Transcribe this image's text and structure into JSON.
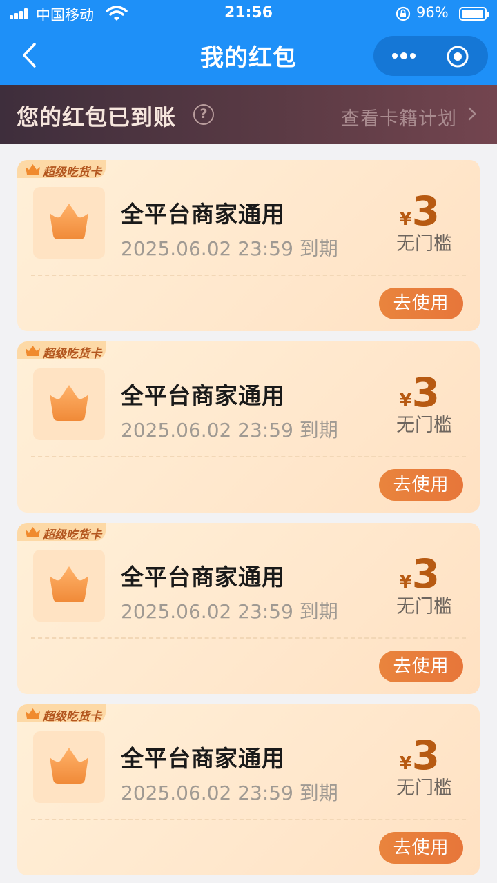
{
  "status_bar": {
    "carrier": "中国移动",
    "time": "21:56",
    "battery_pct": "96%",
    "battery_level": 0.96
  },
  "nav": {
    "title": "我的红包",
    "back_icon": "chevron-left-icon",
    "more_icon": "more-dots-icon",
    "close_icon": "target-icon"
  },
  "banner": {
    "title": "您的红包已到账",
    "link": "查看卡籍计划"
  },
  "colors": {
    "nav_blue": "#1e90f8",
    "accent_orange": "#e9843d",
    "price_brown": "#b75a12"
  },
  "cards": [
    {
      "badge": "超级吃货卡",
      "title": "全平台商家通用",
      "expiry": "2025.06.02 23:59 到期",
      "currency": "¥",
      "amount": "3",
      "threshold": "无门槛",
      "button": "去使用"
    },
    {
      "badge": "超级吃货卡",
      "title": "全平台商家通用",
      "expiry": "2025.06.02 23:59 到期",
      "currency": "¥",
      "amount": "3",
      "threshold": "无门槛",
      "button": "去使用"
    },
    {
      "badge": "超级吃货卡",
      "title": "全平台商家通用",
      "expiry": "2025.06.02 23:59 到期",
      "currency": "¥",
      "amount": "3",
      "threshold": "无门槛",
      "button": "去使用"
    },
    {
      "badge": "超级吃货卡",
      "title": "全平台商家通用",
      "expiry": "2025.06.02 23:59 到期",
      "currency": "¥",
      "amount": "3",
      "threshold": "无门槛",
      "button": "去使用"
    }
  ]
}
